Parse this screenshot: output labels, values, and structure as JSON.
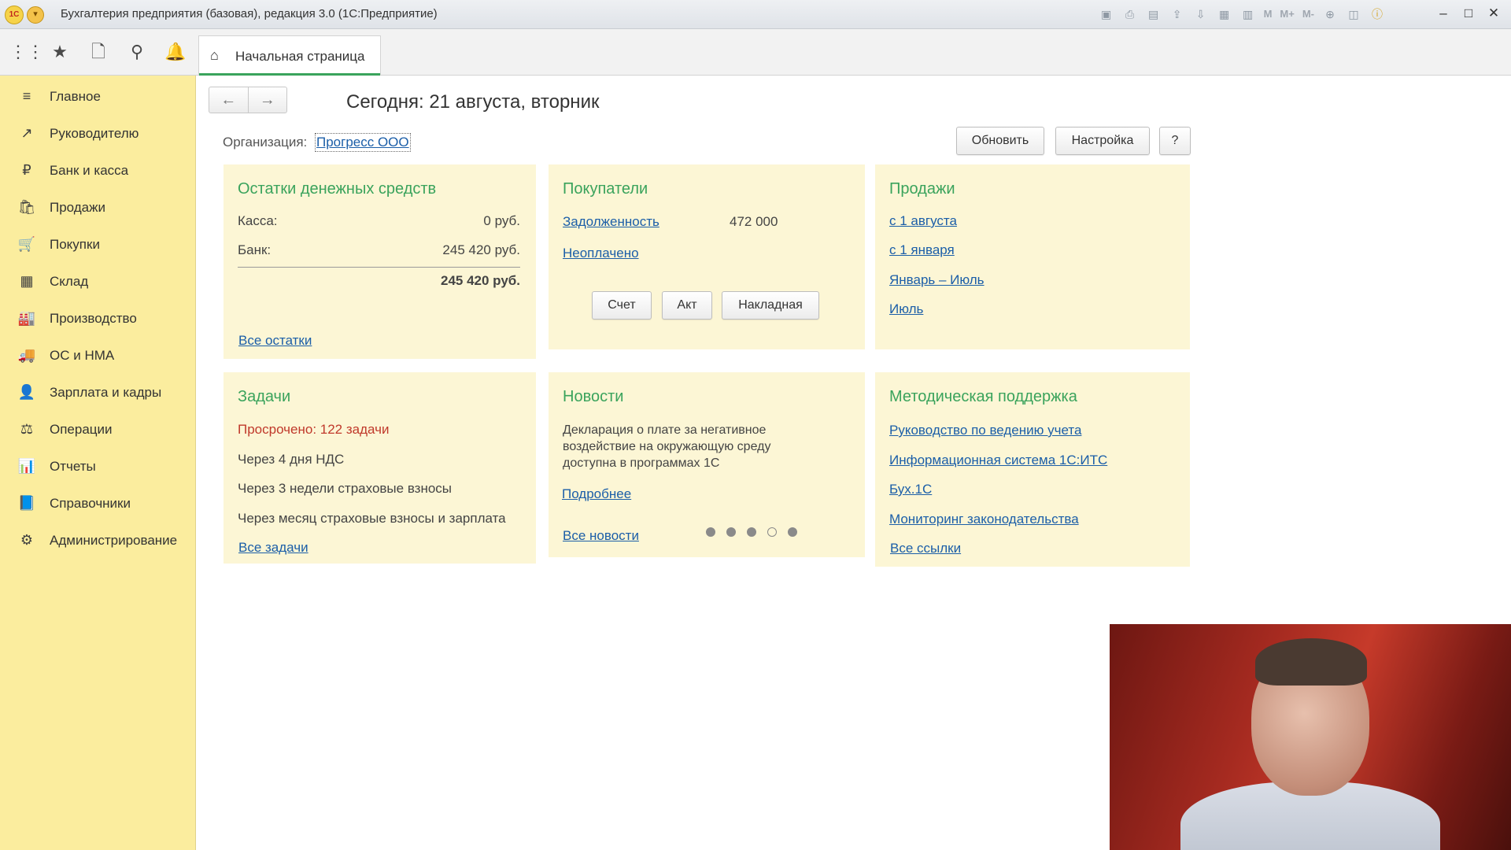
{
  "window": {
    "logo": "1С",
    "title": "Бухгалтерия предприятия (базовая), редакция 3.0  (1С:Предприятие)",
    "toolbar_m": [
      "M",
      "M+",
      "M-"
    ]
  },
  "tabs": [
    {
      "label": "Начальная страница"
    }
  ],
  "sidebar": {
    "items": [
      {
        "label": "Главное",
        "icon": "≡"
      },
      {
        "label": "Руководителю",
        "icon": "↗"
      },
      {
        "label": "Банк и касса",
        "icon": "₽"
      },
      {
        "label": "Продажи",
        "icon": "🛍"
      },
      {
        "label": "Покупки",
        "icon": "🛒"
      },
      {
        "label": "Склад",
        "icon": "▦"
      },
      {
        "label": "Производство",
        "icon": "🏭"
      },
      {
        "label": "ОС и НМА",
        "icon": "🚚"
      },
      {
        "label": "Зарплата и кадры",
        "icon": "👤"
      },
      {
        "label": "Операции",
        "icon": "⚖"
      },
      {
        "label": "Отчеты",
        "icon": "📊"
      },
      {
        "label": "Справочники",
        "icon": "📘"
      },
      {
        "label": "Администрирование",
        "icon": "⚙"
      }
    ]
  },
  "header": {
    "today": "Сегодня: 21 августа, вторник",
    "org_label": "Организация:",
    "org_value": "Прогресс ООО",
    "refresh": "Обновить",
    "settings": "Настройка",
    "help": "?"
  },
  "cash": {
    "title": "Остатки денежных средств",
    "kassa_label": "Касса:",
    "kassa_value": "0 руб.",
    "bank_label": "Банк:",
    "bank_value": "245 420 руб.",
    "total": "245 420 руб.",
    "all_link": "Все остатки"
  },
  "buyers": {
    "title": "Покупатели",
    "debt_link": "Задолженность",
    "debt_value": "472 000",
    "unpaid_link": "Неоплачено",
    "btn_invoice": "Счет",
    "btn_act": "Акт",
    "btn_waybill": "Накладная"
  },
  "sales": {
    "title": "Продажи",
    "links": [
      "с 1 августа",
      "с 1 января",
      "Январь – Июль",
      "Июль"
    ]
  },
  "tasks": {
    "title": "Задачи",
    "overdue": "Просрочено: 122 задачи",
    "items": [
      "Через 4 дня НДС",
      "Через 3 недели страховые взносы",
      "Через месяц страховые взносы и зарплата"
    ],
    "all_link": "Все задачи"
  },
  "news": {
    "title": "Новости",
    "text": "Декларация о плате за негативное воздействие на окружающую среду доступна в программах 1С",
    "more_link": "Подробнее",
    "all_link": "Все новости",
    "active_dot": 4
  },
  "support": {
    "title": "Методическая поддержка",
    "links": [
      "Руководство по ведению учета",
      "Информационная система 1С:ИТС",
      "Бух.1С",
      "Мониторинг законодательства"
    ],
    "all_link": "Все ссылки"
  },
  "colors": {
    "sidebar_bg": "#fbed9e",
    "panel_bg": "#fcf6d5",
    "panel_title": "#3aa35c",
    "link": "#1b5ea8",
    "overdue": "#c0392b"
  }
}
